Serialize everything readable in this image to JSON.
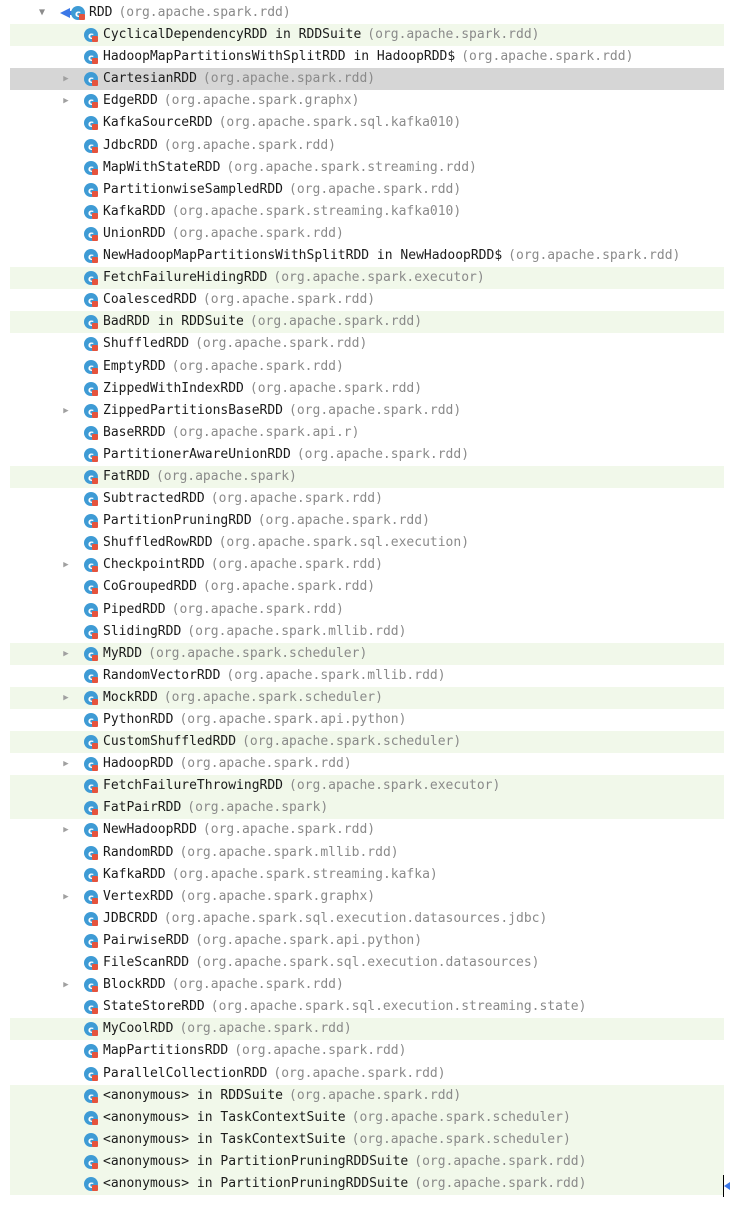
{
  "root": {
    "name": "RDD",
    "pkg": "(org.apache.spark.rdd)",
    "expanded": true
  },
  "children": [
    {
      "name": "CyclicalDependencyRDD in RDDSuite",
      "pkg": "(org.apache.spark.rdd)",
      "test": true,
      "arrow": false
    },
    {
      "name": "HadoopMapPartitionsWithSplitRDD in HadoopRDD$",
      "pkg": "(org.apache.spark.rdd)",
      "test": false,
      "arrow": false
    },
    {
      "name": "CartesianRDD",
      "pkg": "(org.apache.spark.rdd)",
      "test": false,
      "arrow": true,
      "selected": true
    },
    {
      "name": "EdgeRDD",
      "pkg": "(org.apache.spark.graphx)",
      "test": false,
      "arrow": true
    },
    {
      "name": "KafkaSourceRDD",
      "pkg": "(org.apache.spark.sql.kafka010)",
      "test": false,
      "arrow": false
    },
    {
      "name": "JdbcRDD",
      "pkg": "(org.apache.spark.rdd)",
      "test": false,
      "arrow": false
    },
    {
      "name": "MapWithStateRDD",
      "pkg": "(org.apache.spark.streaming.rdd)",
      "test": false,
      "arrow": false
    },
    {
      "name": "PartitionwiseSampledRDD",
      "pkg": "(org.apache.spark.rdd)",
      "test": false,
      "arrow": false
    },
    {
      "name": "KafkaRDD",
      "pkg": "(org.apache.spark.streaming.kafka010)",
      "test": false,
      "arrow": false
    },
    {
      "name": "UnionRDD",
      "pkg": "(org.apache.spark.rdd)",
      "test": false,
      "arrow": false
    },
    {
      "name": "NewHadoopMapPartitionsWithSplitRDD in NewHadoopRDD$",
      "pkg": "(org.apache.spark.rdd)",
      "test": false,
      "arrow": false
    },
    {
      "name": "FetchFailureHidingRDD",
      "pkg": "(org.apache.spark.executor)",
      "test": true,
      "arrow": false
    },
    {
      "name": "CoalescedRDD",
      "pkg": "(org.apache.spark.rdd)",
      "test": false,
      "arrow": false
    },
    {
      "name": "BadRDD in RDDSuite",
      "pkg": "(org.apache.spark.rdd)",
      "test": true,
      "arrow": false
    },
    {
      "name": "ShuffledRDD",
      "pkg": "(org.apache.spark.rdd)",
      "test": false,
      "arrow": false
    },
    {
      "name": "EmptyRDD",
      "pkg": "(org.apache.spark.rdd)",
      "test": false,
      "arrow": false
    },
    {
      "name": "ZippedWithIndexRDD",
      "pkg": "(org.apache.spark.rdd)",
      "test": false,
      "arrow": false
    },
    {
      "name": "ZippedPartitionsBaseRDD",
      "pkg": "(org.apache.spark.rdd)",
      "test": false,
      "arrow": true
    },
    {
      "name": "BaseRRDD",
      "pkg": "(org.apache.spark.api.r)",
      "test": false,
      "arrow": false
    },
    {
      "name": "PartitionerAwareUnionRDD",
      "pkg": "(org.apache.spark.rdd)",
      "test": false,
      "arrow": false
    },
    {
      "name": "FatRDD",
      "pkg": "(org.apache.spark)",
      "test": true,
      "arrow": false
    },
    {
      "name": "SubtractedRDD",
      "pkg": "(org.apache.spark.rdd)",
      "test": false,
      "arrow": false
    },
    {
      "name": "PartitionPruningRDD",
      "pkg": "(org.apache.spark.rdd)",
      "test": false,
      "arrow": false
    },
    {
      "name": "ShuffledRowRDD",
      "pkg": "(org.apache.spark.sql.execution)",
      "test": false,
      "arrow": false
    },
    {
      "name": "CheckpointRDD",
      "pkg": "(org.apache.spark.rdd)",
      "test": false,
      "arrow": true
    },
    {
      "name": "CoGroupedRDD",
      "pkg": "(org.apache.spark.rdd)",
      "test": false,
      "arrow": false
    },
    {
      "name": "PipedRDD",
      "pkg": "(org.apache.spark.rdd)",
      "test": false,
      "arrow": false
    },
    {
      "name": "SlidingRDD",
      "pkg": "(org.apache.spark.mllib.rdd)",
      "test": false,
      "arrow": false
    },
    {
      "name": "MyRDD",
      "pkg": "(org.apache.spark.scheduler)",
      "test": true,
      "arrow": true
    },
    {
      "name": "RandomVectorRDD",
      "pkg": "(org.apache.spark.mllib.rdd)",
      "test": false,
      "arrow": false
    },
    {
      "name": "MockRDD",
      "pkg": "(org.apache.spark.scheduler)",
      "test": true,
      "arrow": true
    },
    {
      "name": "PythonRDD",
      "pkg": "(org.apache.spark.api.python)",
      "test": false,
      "arrow": false
    },
    {
      "name": "CustomShuffledRDD",
      "pkg": "(org.apache.spark.scheduler)",
      "test": true,
      "arrow": false
    },
    {
      "name": "HadoopRDD",
      "pkg": "(org.apache.spark.rdd)",
      "test": false,
      "arrow": true
    },
    {
      "name": "FetchFailureThrowingRDD",
      "pkg": "(org.apache.spark.executor)",
      "test": true,
      "arrow": false
    },
    {
      "name": "FatPairRDD",
      "pkg": "(org.apache.spark)",
      "test": true,
      "arrow": false
    },
    {
      "name": "NewHadoopRDD",
      "pkg": "(org.apache.spark.rdd)",
      "test": false,
      "arrow": true
    },
    {
      "name": "RandomRDD",
      "pkg": "(org.apache.spark.mllib.rdd)",
      "test": false,
      "arrow": false
    },
    {
      "name": "KafkaRDD",
      "pkg": "(org.apache.spark.streaming.kafka)",
      "test": false,
      "arrow": false
    },
    {
      "name": "VertexRDD",
      "pkg": "(org.apache.spark.graphx)",
      "test": false,
      "arrow": true
    },
    {
      "name": "JDBCRDD",
      "pkg": "(org.apache.spark.sql.execution.datasources.jdbc)",
      "test": false,
      "arrow": false
    },
    {
      "name": "PairwiseRDD",
      "pkg": "(org.apache.spark.api.python)",
      "test": false,
      "arrow": false
    },
    {
      "name": "FileScanRDD",
      "pkg": "(org.apache.spark.sql.execution.datasources)",
      "test": false,
      "arrow": false
    },
    {
      "name": "BlockRDD",
      "pkg": "(org.apache.spark.rdd)",
      "test": false,
      "arrow": true
    },
    {
      "name": "StateStoreRDD",
      "pkg": "(org.apache.spark.sql.execution.streaming.state)",
      "test": false,
      "arrow": false
    },
    {
      "name": "MyCoolRDD",
      "pkg": "(org.apache.spark.rdd)",
      "test": true,
      "arrow": false
    },
    {
      "name": "MapPartitionsRDD",
      "pkg": "(org.apache.spark.rdd)",
      "test": false,
      "arrow": false
    },
    {
      "name": "ParallelCollectionRDD",
      "pkg": "(org.apache.spark.rdd)",
      "test": false,
      "arrow": false
    },
    {
      "name": "<anonymous> in RDDSuite",
      "pkg": "(org.apache.spark.rdd)",
      "test": true,
      "arrow": false
    },
    {
      "name": "<anonymous> in TaskContextSuite",
      "pkg": "(org.apache.spark.scheduler)",
      "test": true,
      "arrow": false
    },
    {
      "name": "<anonymous> in TaskContextSuite",
      "pkg": "(org.apache.spark.scheduler)",
      "test": true,
      "arrow": false
    },
    {
      "name": "<anonymous> in PartitionPruningRDDSuite",
      "pkg": "(org.apache.spark.rdd)",
      "test": true,
      "arrow": false
    },
    {
      "name": "<anonymous> in PartitionPruningRDDSuite",
      "pkg": "(org.apache.spark.rdd)",
      "test": true,
      "arrow": false
    }
  ],
  "icon": "class-icon",
  "colors": {
    "test_row": "#f1f8ea",
    "selected_row": "#d6d6d6",
    "package_text": "#8a8a8a",
    "class_icon": "#3e9bd5",
    "lock_badge": "#e5533d"
  }
}
